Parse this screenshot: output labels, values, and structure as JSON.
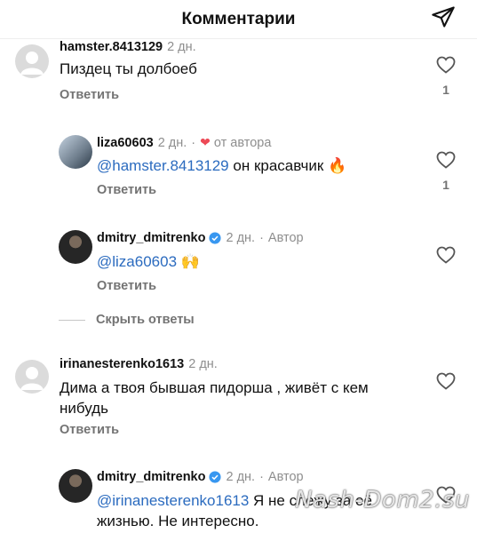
{
  "header": {
    "title": "Комментарии"
  },
  "icons": {
    "send": "send-icon",
    "like": "heart-outline-icon",
    "avatar_default": "default-user-icon",
    "verified": "verified-badge-icon",
    "author_heart": "red-heart-icon"
  },
  "colors": {
    "mention": "#2b6bbf",
    "secondary": "#737373",
    "heart": "#ed4956",
    "verified": "#3897f0"
  },
  "comments": [
    {
      "username": "hamster.8413129",
      "time": "2 дн.",
      "text": "Пиздец ты долбоеб",
      "reply": "Ответить",
      "likes": "1"
    },
    {
      "username": "liza60603",
      "time": "2 дн.",
      "from_author": "от автора",
      "mention": "@hamster.8413129",
      "text": "он красавчик",
      "emoji": "🔥",
      "reply": "Ответить",
      "likes": "1"
    },
    {
      "username": "dmitry_dmitrenko",
      "time": "2 дн.",
      "role": "Автор",
      "mention": "@liza60603",
      "emoji": "🙌",
      "reply": "Ответить"
    },
    {
      "username": "irinanesterenko1613",
      "time": "2 дн.",
      "text_line1": "Дима а твоя бывшая пидорша , живёт с кем",
      "text_line2": "нибудь",
      "reply": "Ответить"
    },
    {
      "username": "dmitry_dmitrenko",
      "time": "2 дн.",
      "role": "Автор",
      "mention": "@irinanesterenko1613",
      "text_line1": "Я не слежу за её",
      "text_line2": "жизнью. Не интересно."
    }
  ],
  "hide_replies": "Скрыть ответы",
  "watermark": "Nash-Dom2.su"
}
